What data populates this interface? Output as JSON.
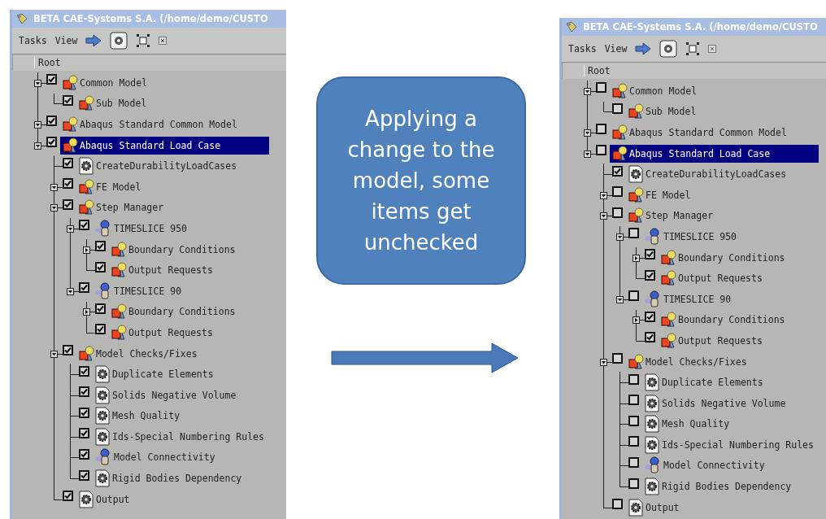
{
  "panels": [
    {
      "title": "BETA CAE-Systems S.A. (/home/demo/CUSTO",
      "menus": [
        "Tasks",
        "View"
      ],
      "column_header": "Root",
      "tree": [
        {
          "label": "Common Model",
          "kind": "model",
          "checked": true,
          "selected": false,
          "expanded": true,
          "children": [
            {
              "label": "Sub Model",
              "kind": "model",
              "checked": true,
              "selected": false
            }
          ]
        },
        {
          "label": "Abaqus Standard Common Model",
          "kind": "model",
          "checked": true,
          "selected": false,
          "expanded": true
        },
        {
          "label": "Abaqus Standard Load Case",
          "kind": "model",
          "checked": true,
          "selected": true,
          "expanded": true,
          "children": [
            {
              "label": "CreateDurabilityLoadCases",
              "kind": "task",
              "checked": true,
              "selected": false
            },
            {
              "label": "FE Model",
              "kind": "model",
              "checked": true,
              "selected": false,
              "expanded": true
            },
            {
              "label": "Step Manager",
              "kind": "model",
              "checked": true,
              "selected": false,
              "expanded": true,
              "children": [
                {
                  "label": "TIMESLICE 950",
                  "kind": "slice",
                  "checked": true,
                  "selected": false,
                  "expanded": true,
                  "children": [
                    {
                      "label": "Boundary Conditions",
                      "kind": "model",
                      "checked": true,
                      "selected": false,
                      "expanded": false
                    },
                    {
                      "label": "Output Requests",
                      "kind": "model",
                      "checked": true,
                      "selected": false
                    }
                  ]
                },
                {
                  "label": "TIMESLICE 90",
                  "kind": "slice",
                  "checked": true,
                  "selected": false,
                  "expanded": true,
                  "children": [
                    {
                      "label": "Boundary Conditions",
                      "kind": "model",
                      "checked": true,
                      "selected": false,
                      "expanded": false
                    },
                    {
                      "label": "Output Requests",
                      "kind": "model",
                      "checked": true,
                      "selected": false
                    }
                  ]
                }
              ]
            },
            {
              "label": "Model Checks/Fixes",
              "kind": "model",
              "checked": true,
              "selected": false,
              "expanded": true,
              "children": [
                {
                  "label": "Duplicate Elements",
                  "kind": "task",
                  "checked": true,
                  "selected": false
                },
                {
                  "label": "Solids Negative Volume",
                  "kind": "task",
                  "checked": true,
                  "selected": false
                },
                {
                  "label": "Mesh Quality",
                  "kind": "task",
                  "checked": true,
                  "selected": false
                },
                {
                  "label": "Ids-Special Numbering Rules",
                  "kind": "task",
                  "checked": true,
                  "selected": false
                },
                {
                  "label": "Model Connectivity",
                  "kind": "slice",
                  "checked": true,
                  "selected": false
                },
                {
                  "label": "Rigid Bodies Dependency",
                  "kind": "task",
                  "checked": true,
                  "selected": false
                }
              ]
            },
            {
              "label": "Output",
              "kind": "task",
              "checked": true,
              "selected": false
            }
          ]
        }
      ]
    },
    {
      "title": "BETA CAE-Systems S.A. (/home/demo/CUSTO",
      "menus": [
        "Tasks",
        "View"
      ],
      "column_header": "Root",
      "tree": [
        {
          "label": "Common Model",
          "kind": "model",
          "checked": false,
          "selected": false,
          "expanded": true,
          "children": [
            {
              "label": "Sub Model",
              "kind": "model",
              "checked": false,
              "selected": false
            }
          ]
        },
        {
          "label": "Abaqus Standard Common Model",
          "kind": "model",
          "checked": false,
          "selected": false,
          "expanded": true
        },
        {
          "label": "Abaqus Standard Load Case",
          "kind": "model",
          "checked": false,
          "selected": true,
          "expanded": true,
          "children": [
            {
              "label": "CreateDurabilityLoadCases",
              "kind": "task",
              "checked": true,
              "selected": false
            },
            {
              "label": "FE Model",
              "kind": "model",
              "checked": false,
              "selected": false,
              "expanded": true
            },
            {
              "label": "Step Manager",
              "kind": "model",
              "checked": false,
              "selected": false,
              "expanded": true,
              "children": [
                {
                  "label": "TIMESLICE 950",
                  "kind": "slice",
                  "checked": false,
                  "selected": false,
                  "expanded": true,
                  "children": [
                    {
                      "label": "Boundary Conditions",
                      "kind": "model",
                      "checked": true,
                      "selected": false,
                      "expanded": false
                    },
                    {
                      "label": "Output Requests",
                      "kind": "model",
                      "checked": true,
                      "selected": false
                    }
                  ]
                },
                {
                  "label": "TIMESLICE 90",
                  "kind": "slice",
                  "checked": false,
                  "selected": false,
                  "expanded": true,
                  "children": [
                    {
                      "label": "Boundary Conditions",
                      "kind": "model",
                      "checked": true,
                      "selected": false,
                      "expanded": false
                    },
                    {
                      "label": "Output Requests",
                      "kind": "model",
                      "checked": true,
                      "selected": false
                    }
                  ]
                }
              ]
            },
            {
              "label": "Model Checks/Fixes",
              "kind": "model",
              "checked": false,
              "selected": false,
              "expanded": true,
              "children": [
                {
                  "label": "Duplicate Elements",
                  "kind": "task",
                  "checked": false,
                  "selected": false
                },
                {
                  "label": "Solids Negative Volume",
                  "kind": "task",
                  "checked": false,
                  "selected": false
                },
                {
                  "label": "Mesh Quality",
                  "kind": "task",
                  "checked": false,
                  "selected": false
                },
                {
                  "label": "Ids-Special Numbering Rules",
                  "kind": "task",
                  "checked": false,
                  "selected": false
                },
                {
                  "label": "Model Connectivity",
                  "kind": "slice",
                  "checked": false,
                  "selected": false
                },
                {
                  "label": "Rigid Bodies Dependency",
                  "kind": "task",
                  "checked": false,
                  "selected": false
                }
              ]
            },
            {
              "label": "Output",
              "kind": "task",
              "checked": false,
              "selected": false
            }
          ]
        }
      ]
    }
  ],
  "callout": {
    "text": "Applying a change to the model, some items get unchecked"
  }
}
